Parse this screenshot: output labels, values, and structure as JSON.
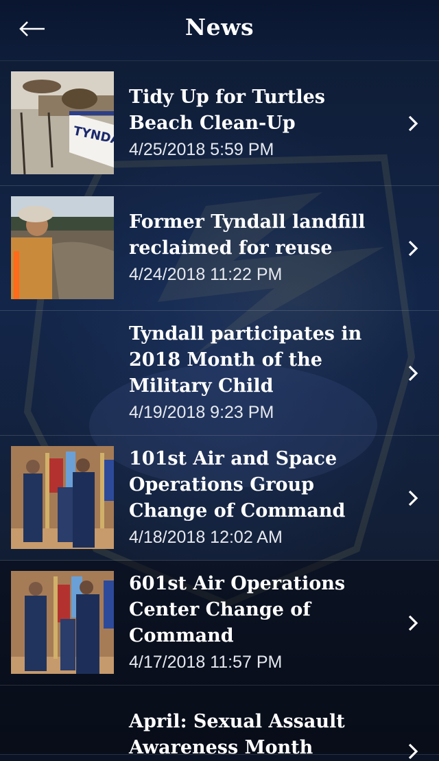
{
  "header": {
    "title": "News",
    "back_icon": "arrow-left-icon"
  },
  "colors": {
    "header_bg": "#0e1d3a",
    "text": "#ffffff"
  },
  "news_items": [
    {
      "title": "Tidy Up for Turtles Beach Clean-Up",
      "date": "4/25/2018 5:59 PM",
      "has_thumbnail": true,
      "thumbnail_text": "TYNDAL"
    },
    {
      "title": "Former Tyndall landfill reclaimed for reuse",
      "date": "4/24/2018 11:22 PM",
      "has_thumbnail": true
    },
    {
      "title": "Tyndall participates in 2018 Month of the Military Child",
      "date": "4/19/2018 9:23 PM",
      "has_thumbnail": false
    },
    {
      "title": "101st Air and Space Operations Group Change of Command",
      "date": "4/18/2018 12:02 AM",
      "has_thumbnail": true
    },
    {
      "title": "601st Air Operations Center Change of Command",
      "date": "4/17/2018 11:57 PM",
      "has_thumbnail": true
    },
    {
      "title": "April: Sexual Assault Awareness Month",
      "date": "",
      "has_thumbnail": false
    }
  ]
}
